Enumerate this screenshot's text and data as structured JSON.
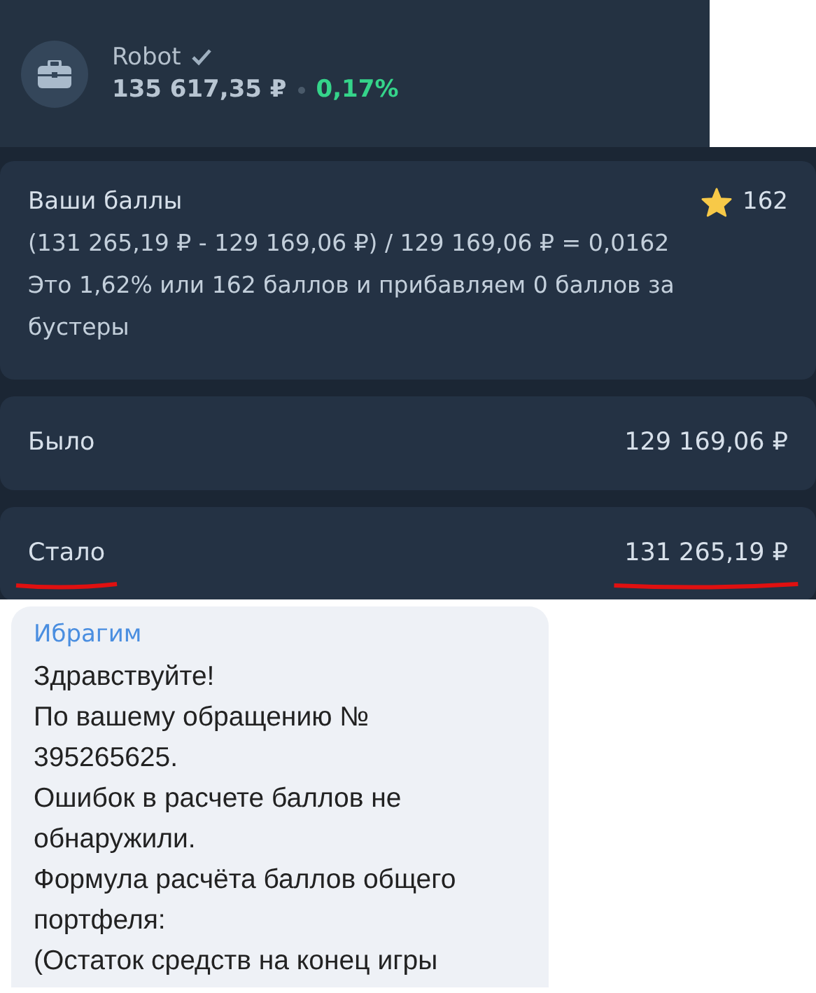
{
  "portfolio": {
    "name": "Robot",
    "verified": true,
    "value": "135 617,35 ₽",
    "change": "0,17%"
  },
  "score_card": {
    "title": "Ваши баллы",
    "points": "162",
    "lines": [
      "(131 265,19 ₽ - 129 169,06 ₽) / 129 169,06 ₽ = 0,0162",
      "Это 1,62% или 162 баллов и прибавляем 0 баллов за бустеры"
    ]
  },
  "rows": [
    {
      "label": "Было",
      "value": "129 169,06 ₽",
      "underlined": false
    },
    {
      "label": "Стало",
      "value": "131 265,19 ₽",
      "underlined": true
    }
  ],
  "message": {
    "sender": "Ибрагим",
    "paragraphs": [
      "Здравствуйте!",
      "По вашему обращению № 395265625.",
      "Ошибок в расчете баллов не обнаружили.",
      "Формула расчёта баллов общего портфеля:",
      "(Остаток средств на конец игры"
    ]
  }
}
